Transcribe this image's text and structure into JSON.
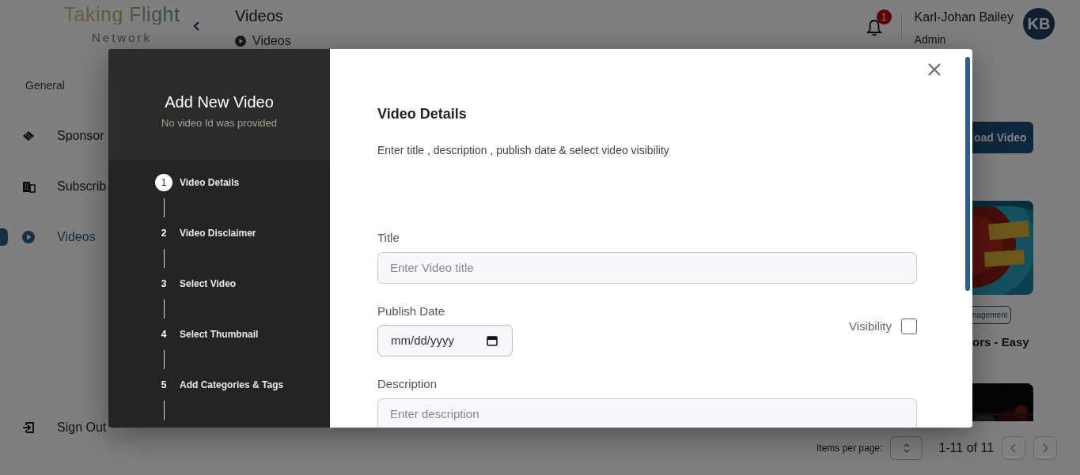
{
  "header": {
    "logo_title": "Taking Flight",
    "logo_subtitle": "Network",
    "page_title": "Videos",
    "breadcrumb": "Videos",
    "notification_count": "1",
    "user_name": "Karl-Johan Bailey",
    "user_role": "Admin",
    "user_initials": "KB"
  },
  "sidebar": {
    "section": "General",
    "items": [
      {
        "label": "Sponsor",
        "selected": false
      },
      {
        "label": "Subscrib",
        "selected": false
      },
      {
        "label": "Videos",
        "selected": true
      }
    ],
    "sign_out": "Sign Out"
  },
  "content": {
    "upload_button": "oad Video",
    "tag": "nagement",
    "video_title": "ors - Easy"
  },
  "pagination": {
    "items_per_page": "Items per page:",
    "range": "1-11 of 11"
  },
  "modal": {
    "title": "Add New Video",
    "subtitle": "No video Id was provided",
    "steps": [
      {
        "number": "1",
        "label": "Video Details",
        "selected": true
      },
      {
        "number": "2",
        "label": "Video Disclaimer",
        "selected": false
      },
      {
        "number": "3",
        "label": "Select Video",
        "selected": false
      },
      {
        "number": "4",
        "label": "Select Thumbnail",
        "selected": false
      },
      {
        "number": "5",
        "label": "Add Categories & Tags",
        "selected": false
      }
    ],
    "section_title": "Video Details",
    "section_description": "Enter title , description , publish date & select video visibility",
    "title_field": {
      "label": "Title",
      "placeholder": "Enter Video title"
    },
    "publish_date": {
      "label": "Publish Date",
      "placeholder": "mm/dd/yyyy"
    },
    "visibility": {
      "label": "Visibility",
      "checked": false
    },
    "description": {
      "label": "Description",
      "placeholder": "Enter description"
    }
  }
}
